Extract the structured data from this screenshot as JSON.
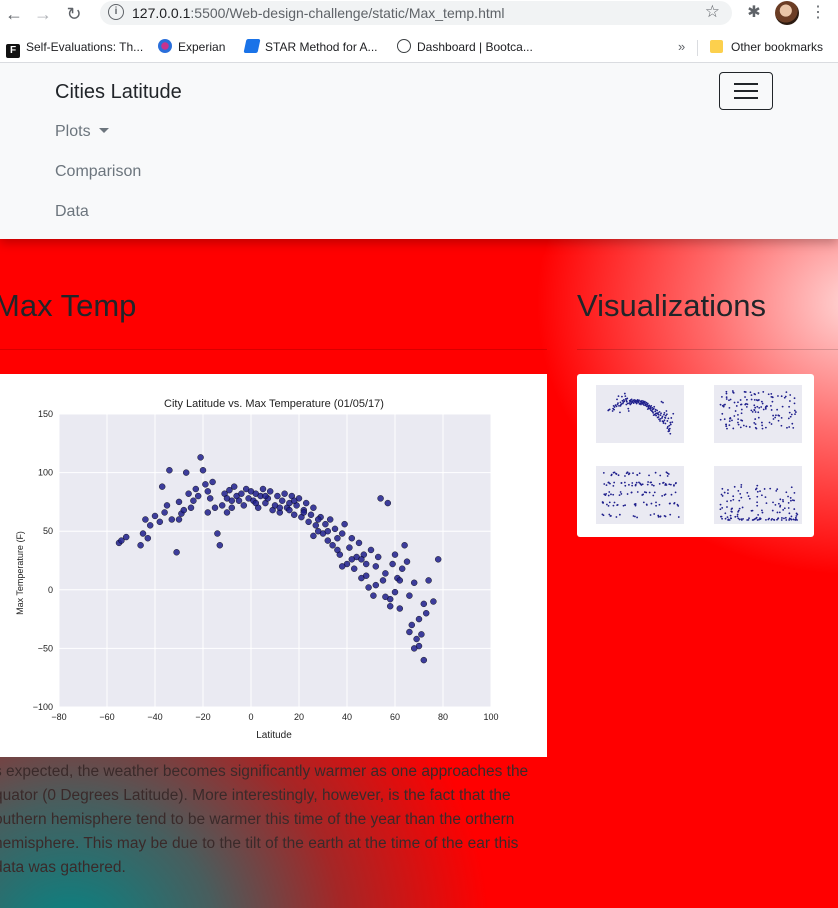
{
  "browser": {
    "url_host": "127.0.0.1",
    "url_path": ":5500/Web-design-challenge/static/Max_temp.html",
    "bookmarks": [
      {
        "label": "Self-Evaluations: Th...",
        "icon": "F"
      },
      {
        "label": "Experian",
        "icon": "experian-icon"
      },
      {
        "label": "STAR Method for A...",
        "icon": "star-method-icon"
      },
      {
        "label": "Dashboard | Bootca...",
        "icon": "globe-icon"
      }
    ],
    "more_bookmarks": "»",
    "other_bookmarks": "Other bookmarks"
  },
  "navbar": {
    "brand": "Cities Latitude",
    "links": [
      "Plots",
      "Comparison",
      "Data"
    ]
  },
  "main": {
    "heading": "Max Temp",
    "caption": "s expected, the weather becomes significantly warmer as one approaches the quator (0 Degrees Latitude). More interestingly, however, is the fact that the outhern hemisphere tend to be warmer this time of the year than the orthern hemisphere. This may be due to the tilt of the earth at the time of the ear this data was gathered."
  },
  "sidebar": {
    "heading": "Visualizations"
  },
  "colors": {
    "accent": "#ff0000",
    "teal": "#008787",
    "point": "#1f1f8c",
    "plot_bg": "#eaeaf2"
  },
  "chart_data": {
    "type": "scatter",
    "title": "City Latitude vs. Max Temperature (01/05/17)",
    "xlabel": "Latitude",
    "ylabel": "Max Temperature (F)",
    "xlim": [
      -80,
      100
    ],
    "ylim": [
      -100,
      150
    ],
    "xticks": [
      -80,
      -60,
      -40,
      -20,
      0,
      20,
      40,
      60,
      80,
      100
    ],
    "yticks": [
      -100,
      -50,
      0,
      50,
      100,
      150
    ],
    "grid": true,
    "points": [
      [
        -55,
        40
      ],
      [
        -54,
        42
      ],
      [
        -52,
        45
      ],
      [
        -46,
        38
      ],
      [
        -45,
        48
      ],
      [
        -43,
        44
      ],
      [
        -42,
        55
      ],
      [
        -40,
        63
      ],
      [
        -38,
        58
      ],
      [
        -37,
        88
      ],
      [
        -35,
        72
      ],
      [
        -34,
        102
      ],
      [
        -33,
        60
      ],
      [
        -31,
        32
      ],
      [
        -30,
        75
      ],
      [
        -29,
        65
      ],
      [
        -27,
        100
      ],
      [
        -26,
        82
      ],
      [
        -25,
        70
      ],
      [
        -24,
        76
      ],
      [
        -23,
        86
      ],
      [
        -22,
        80
      ],
      [
        -21,
        113
      ],
      [
        -20,
        102
      ],
      [
        -19,
        90
      ],
      [
        -18,
        84
      ],
      [
        -17,
        78
      ],
      [
        -16,
        92
      ],
      [
        -15,
        70
      ],
      [
        -14,
        48
      ],
      [
        -13,
        38
      ],
      [
        -12,
        72
      ],
      [
        -11,
        82
      ],
      [
        -10,
        78
      ],
      [
        -9,
        85
      ],
      [
        -8,
        70
      ],
      [
        -7,
        88
      ],
      [
        -6,
        80
      ],
      [
        -5,
        76
      ],
      [
        -4,
        82
      ],
      [
        -3,
        72
      ],
      [
        -2,
        86
      ],
      [
        -1,
        78
      ],
      [
        0,
        84
      ],
      [
        1,
        76
      ],
      [
        2,
        82
      ],
      [
        3,
        70
      ],
      [
        4,
        80
      ],
      [
        5,
        86
      ],
      [
        6,
        74
      ],
      [
        7,
        78
      ],
      [
        8,
        84
      ],
      [
        9,
        68
      ],
      [
        10,
        72
      ],
      [
        11,
        80
      ],
      [
        12,
        66
      ],
      [
        13,
        76
      ],
      [
        14,
        82
      ],
      [
        15,
        70
      ],
      [
        16,
        74
      ],
      [
        17,
        80
      ],
      [
        18,
        64
      ],
      [
        19,
        72
      ],
      [
        20,
        78
      ],
      [
        21,
        62
      ],
      [
        22,
        68
      ],
      [
        23,
        74
      ],
      [
        24,
        58
      ],
      [
        25,
        64
      ],
      [
        26,
        70
      ],
      [
        27,
        55
      ],
      [
        28,
        50
      ],
      [
        29,
        62
      ],
      [
        30,
        48
      ],
      [
        31,
        56
      ],
      [
        32,
        42
      ],
      [
        33,
        60
      ],
      [
        34,
        38
      ],
      [
        35,
        52
      ],
      [
        36,
        44
      ],
      [
        37,
        30
      ],
      [
        38,
        48
      ],
      [
        39,
        56
      ],
      [
        40,
        22
      ],
      [
        41,
        36
      ],
      [
        42,
        44
      ],
      [
        43,
        18
      ],
      [
        44,
        28
      ],
      [
        45,
        40
      ],
      [
        46,
        10
      ],
      [
        47,
        30
      ],
      [
        48,
        22
      ],
      [
        49,
        2
      ],
      [
        50,
        34
      ],
      [
        51,
        -5
      ],
      [
        52,
        20
      ],
      [
        53,
        28
      ],
      [
        54,
        78
      ],
      [
        55,
        8
      ],
      [
        56,
        14
      ],
      [
        57,
        74
      ],
      [
        58,
        -8
      ],
      [
        59,
        22
      ],
      [
        60,
        30
      ],
      [
        61,
        10
      ],
      [
        62,
        -16
      ],
      [
        63,
        18
      ],
      [
        64,
        38
      ],
      [
        65,
        24
      ],
      [
        66,
        -5
      ],
      [
        67,
        -30
      ],
      [
        68,
        6
      ],
      [
        69,
        -42
      ],
      [
        70,
        -48
      ],
      [
        71,
        -38
      ],
      [
        72,
        -60
      ],
      [
        73,
        -20
      ],
      [
        74,
        8
      ],
      [
        76,
        -10
      ],
      [
        78,
        26
      ],
      [
        -44,
        60
      ],
      [
        -36,
        66
      ],
      [
        -28,
        68
      ],
      [
        -18,
        66
      ],
      [
        -8,
        76
      ],
      [
        2,
        74
      ],
      [
        12,
        70
      ],
      [
        22,
        66
      ],
      [
        32,
        50
      ],
      [
        42,
        26
      ],
      [
        52,
        4
      ],
      [
        60,
        -2
      ],
      [
        66,
        -36
      ],
      [
        70,
        -25
      ],
      [
        62,
        8
      ],
      [
        56,
        -6
      ],
      [
        46,
        26
      ],
      [
        36,
        34
      ],
      [
        26,
        46
      ],
      [
        16,
        68
      ],
      [
        -30,
        60
      ],
      [
        -10,
        66
      ],
      [
        6,
        80
      ],
      [
        18,
        76
      ],
      [
        28,
        60
      ],
      [
        38,
        20
      ],
      [
        48,
        12
      ],
      [
        58,
        -14
      ],
      [
        68,
        -50
      ],
      [
        72,
        -12
      ]
    ]
  }
}
